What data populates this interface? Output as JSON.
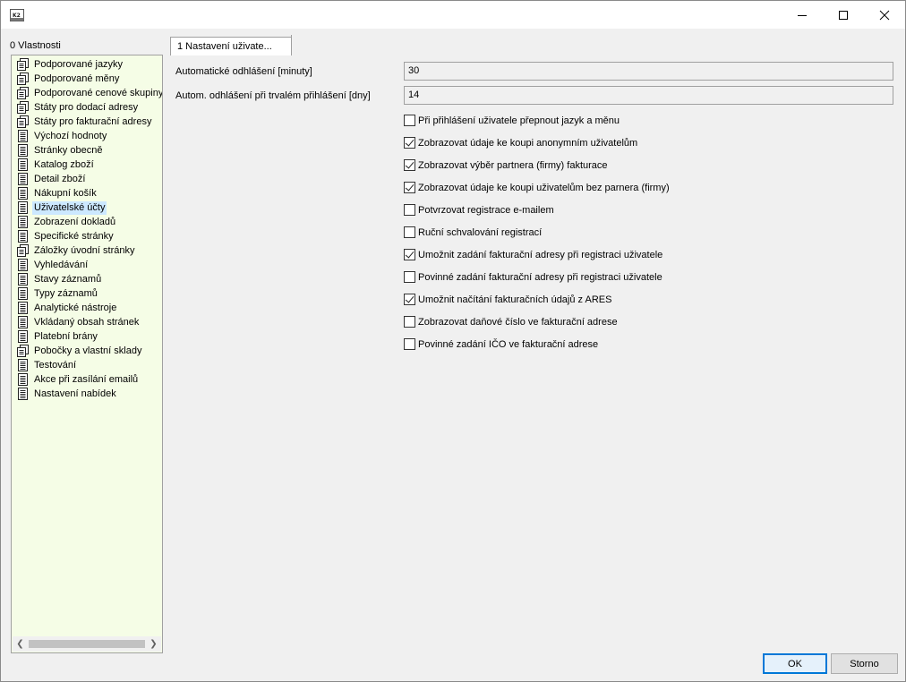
{
  "window": {
    "app_icon": "k2-app-icon",
    "controls": [
      "minimize-icon",
      "maximize-icon",
      "close-icon"
    ]
  },
  "left_panel": {
    "label": "0 Vlastnosti",
    "items": [
      {
        "label": "Podporované jazyky",
        "icon": "document-stack-icon"
      },
      {
        "label": "Podporované měny",
        "icon": "document-stack-icon"
      },
      {
        "label": "Podporované cenové skupiny",
        "icon": "document-stack-icon"
      },
      {
        "label": "Státy pro dodací adresy",
        "icon": "document-stack-icon"
      },
      {
        "label": "Státy pro fakturační adresy",
        "icon": "document-stack-icon"
      },
      {
        "label": "Výchozí hodnoty",
        "icon": "document-icon"
      },
      {
        "label": "Stránky obecně",
        "icon": "document-icon"
      },
      {
        "label": "Katalog zboží",
        "icon": "document-icon"
      },
      {
        "label": "Detail zboží",
        "icon": "document-icon"
      },
      {
        "label": "Nákupní košík",
        "icon": "document-icon"
      },
      {
        "label": "Uživatelské účty",
        "icon": "document-icon",
        "selected": true
      },
      {
        "label": "Zobrazení dokladů",
        "icon": "document-icon"
      },
      {
        "label": "Specifické stránky",
        "icon": "document-icon"
      },
      {
        "label": "Záložky úvodní stránky",
        "icon": "document-stack-icon"
      },
      {
        "label": "Vyhledávání",
        "icon": "document-icon"
      },
      {
        "label": "Stavy záznamů",
        "icon": "document-icon"
      },
      {
        "label": "Typy záznamů",
        "icon": "document-icon"
      },
      {
        "label": "Analytické nástroje",
        "icon": "document-icon"
      },
      {
        "label": "Vkládaný obsah stránek",
        "icon": "document-icon"
      },
      {
        "label": "Platební brány",
        "icon": "document-icon"
      },
      {
        "label": "Pobočky a vlastní sklady",
        "icon": "document-stack-icon"
      },
      {
        "label": "Testování",
        "icon": "document-icon"
      },
      {
        "label": "Akce při zasílání emailů",
        "icon": "document-icon"
      },
      {
        "label": "Nastavení nabídek",
        "icon": "document-icon"
      }
    ]
  },
  "tab": {
    "label": "1 Nastavení uživate..."
  },
  "fields": [
    {
      "label": "Automatické odhlášení [minuty]",
      "value": "30"
    },
    {
      "label": "Autom. odhlášení při trvalém přihlášení [dny]",
      "value": "14"
    }
  ],
  "checkboxes": [
    {
      "label": "Při přihlášení uživatele přepnout jazyk a měnu",
      "checked": false
    },
    {
      "label": "Zobrazovat údaje ke koupi anonymním uživatelům",
      "checked": true
    },
    {
      "label": "Zobrazovat výběr partnera (firmy) fakturace",
      "checked": true
    },
    {
      "label": "Zobrazovat údaje ke koupi uživatelům bez parnera (firmy)",
      "checked": true
    },
    {
      "label": "Potvrzovat registrace e-mailem",
      "checked": false
    },
    {
      "label": "Ruční schvalování registrací",
      "checked": false
    },
    {
      "label": "Umožnit zadání fakturační adresy při registraci uživatele",
      "checked": true
    },
    {
      "label": "Povinné zadání fakturační adresy při registraci uživatele",
      "checked": false
    },
    {
      "label": "Umožnit načítání fakturačních údajů z ARES",
      "checked": true
    },
    {
      "label": "Zobrazovat daňové číslo ve fakturační adrese",
      "checked": false
    },
    {
      "label": "Povinné zadání IČO ve fakturační adrese",
      "checked": false
    }
  ],
  "buttons": {
    "ok": "OK",
    "cancel": "Storno"
  }
}
